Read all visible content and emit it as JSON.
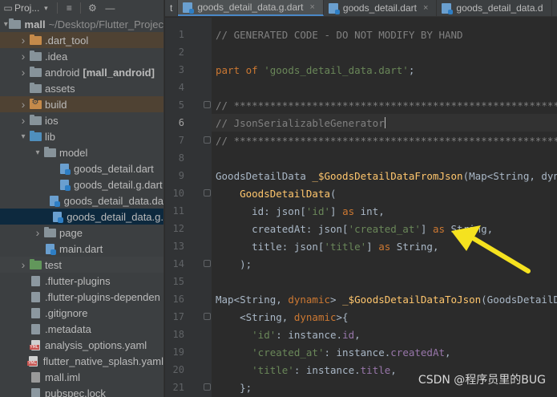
{
  "project_panel": {
    "title": "Proj...",
    "tree": [
      {
        "label": "mall",
        "extra": "~/Desktop/Flutter_Projec",
        "depth": 0,
        "arrow": "down",
        "icon": "folder",
        "bold": true
      },
      {
        "label": ".dart_tool",
        "depth": 1,
        "arrow": "right",
        "icon": "folder-orange",
        "style": "excluded"
      },
      {
        "label": ".idea",
        "depth": 1,
        "arrow": "right",
        "icon": "folder"
      },
      {
        "label": "android",
        "extra": "[mall_android]",
        "depth": 1,
        "arrow": "right",
        "icon": "folder",
        "extra_bold": true
      },
      {
        "label": "assets",
        "depth": 1,
        "arrow": "",
        "icon": "folder"
      },
      {
        "label": "build",
        "depth": 1,
        "arrow": "right",
        "icon": "folder-orange-gear",
        "style": "excluded"
      },
      {
        "label": "ios",
        "depth": 1,
        "arrow": "right",
        "icon": "folder"
      },
      {
        "label": "lib",
        "depth": 1,
        "arrow": "down",
        "icon": "folder-blue"
      },
      {
        "label": "model",
        "depth": 2,
        "arrow": "down",
        "icon": "folder"
      },
      {
        "label": "goods_detail.dart",
        "depth": 3,
        "arrow": "",
        "icon": "file-dart"
      },
      {
        "label": "goods_detail.g.dart",
        "depth": 3,
        "arrow": "",
        "icon": "file-dart"
      },
      {
        "label": "goods_detail_data.da",
        "depth": 3,
        "arrow": "",
        "icon": "file-dart"
      },
      {
        "label": "goods_detail_data.g.",
        "depth": 3,
        "arrow": "",
        "icon": "file-dart",
        "style": "selected"
      },
      {
        "label": "page",
        "depth": 2,
        "arrow": "right",
        "icon": "folder"
      },
      {
        "label": "main.dart",
        "depth": 2,
        "arrow": "",
        "icon": "file-dart"
      },
      {
        "label": "test",
        "depth": 1,
        "arrow": "right",
        "icon": "folder-green",
        "style": "light"
      },
      {
        "label": ".flutter-plugins",
        "depth": 1,
        "arrow": "",
        "icon": "file-plain"
      },
      {
        "label": ".flutter-plugins-dependen",
        "depth": 1,
        "arrow": "",
        "icon": "file-plain"
      },
      {
        "label": ".gitignore",
        "depth": 1,
        "arrow": "",
        "icon": "file-plain"
      },
      {
        "label": ".metadata",
        "depth": 1,
        "arrow": "",
        "icon": "file-plain"
      },
      {
        "label": "analysis_options.yaml",
        "depth": 1,
        "arrow": "",
        "icon": "file-yaml"
      },
      {
        "label": "flutter_native_splash.yaml",
        "depth": 1,
        "arrow": "",
        "icon": "file-yaml"
      },
      {
        "label": "mall.iml",
        "depth": 1,
        "arrow": "",
        "icon": "file-iml"
      },
      {
        "label": "pubspec.lock",
        "depth": 1,
        "arrow": "",
        "icon": "file-plain"
      }
    ]
  },
  "tabs": {
    "fragment": "t",
    "items": [
      {
        "label": "goods_detail_data.g.dart",
        "active": true
      },
      {
        "label": "goods_detail.dart",
        "active": false
      },
      {
        "label": "goods_detail_data.d",
        "active": false
      }
    ]
  },
  "editor": {
    "current_line": 6,
    "lines": [
      {
        "n": "1",
        "tokens": [
          [
            "c-com",
            "// GENERATED CODE - DO NOT MODIFY BY HAND"
          ]
        ]
      },
      {
        "n": "2",
        "tokens": []
      },
      {
        "n": "3",
        "tokens": [
          [
            "c-kw",
            "part of "
          ],
          [
            "c-str",
            "'goods_detail_data.dart'"
          ],
          [
            "c-cls",
            ";"
          ]
        ]
      },
      {
        "n": "4",
        "tokens": []
      },
      {
        "n": "5",
        "fold": true,
        "tokens": [
          [
            "c-com",
            "// **************************************************************************"
          ]
        ]
      },
      {
        "n": "6",
        "tokens": [
          [
            "c-com",
            "// JsonSerializableGenerator"
          ]
        ],
        "caret": true
      },
      {
        "n": "7",
        "fold": true,
        "tokens": [
          [
            "c-com",
            "// **************************************************************************"
          ]
        ]
      },
      {
        "n": "8",
        "tokens": []
      },
      {
        "n": "9",
        "tokens": [
          [
            "c-cls",
            "GoodsDetailData "
          ],
          [
            "c-fn",
            "_$GoodsDetailDataFromJson"
          ],
          [
            "c-cls",
            "(Map<String, dynamic> json) =>"
          ]
        ]
      },
      {
        "n": "10",
        "fold": true,
        "tokens": [
          [
            "c-cls",
            "    "
          ],
          [
            "c-fn",
            "GoodsDetailData"
          ],
          [
            "c-cls",
            "("
          ]
        ]
      },
      {
        "n": "11",
        "tokens": [
          [
            "c-cls",
            "      id: json["
          ],
          [
            "c-str",
            "'id'"
          ],
          [
            "c-cls",
            "] "
          ],
          [
            "c-kw",
            "as "
          ],
          [
            "c-cls",
            "int,"
          ]
        ]
      },
      {
        "n": "12",
        "tokens": [
          [
            "c-cls",
            "      createdAt: json["
          ],
          [
            "c-str",
            "'created_at'"
          ],
          [
            "c-cls",
            "] "
          ],
          [
            "c-kw",
            "as "
          ],
          [
            "c-cls",
            "String,"
          ]
        ]
      },
      {
        "n": "13",
        "tokens": [
          [
            "c-cls",
            "      title: json["
          ],
          [
            "c-str",
            "'title'"
          ],
          [
            "c-cls",
            "] "
          ],
          [
            "c-kw",
            "as "
          ],
          [
            "c-cls",
            "String,"
          ]
        ]
      },
      {
        "n": "14",
        "fold": true,
        "tokens": [
          [
            "c-cls",
            "    );"
          ]
        ]
      },
      {
        "n": "15",
        "tokens": []
      },
      {
        "n": "16",
        "tokens": [
          [
            "c-cls",
            "Map<String, "
          ],
          [
            "c-kw",
            "dynamic"
          ],
          [
            "c-cls",
            "> "
          ],
          [
            "c-fn",
            "_$GoodsDetailDataToJson"
          ],
          [
            "c-cls",
            "(GoodsDetailData instance) =>"
          ]
        ]
      },
      {
        "n": "17",
        "fold": true,
        "tokens": [
          [
            "c-cls",
            "    <String, "
          ],
          [
            "c-kw",
            "dynamic"
          ],
          [
            "c-cls",
            ">{"
          ]
        ]
      },
      {
        "n": "18",
        "tokens": [
          [
            "c-cls",
            "      "
          ],
          [
            "c-str",
            "'id'"
          ],
          [
            "c-cls",
            ": instance."
          ],
          [
            "c-prop",
            "id"
          ],
          [
            "c-cls",
            ","
          ]
        ]
      },
      {
        "n": "19",
        "tokens": [
          [
            "c-cls",
            "      "
          ],
          [
            "c-str",
            "'created_at'"
          ],
          [
            "c-cls",
            ": instance."
          ],
          [
            "c-prop",
            "createdAt"
          ],
          [
            "c-cls",
            ","
          ]
        ]
      },
      {
        "n": "20",
        "tokens": [
          [
            "c-cls",
            "      "
          ],
          [
            "c-str",
            "'title'"
          ],
          [
            "c-cls",
            ": instance."
          ],
          [
            "c-prop",
            "title"
          ],
          [
            "c-cls",
            ","
          ]
        ]
      },
      {
        "n": "21",
        "fold": true,
        "tokens": [
          [
            "c-cls",
            "    };"
          ]
        ]
      }
    ]
  },
  "watermark": "CSDN @程序员里的BUG",
  "colors": {
    "arrow": "#f5e21f",
    "selected_row": "#0d293e",
    "excluded_row": "#4f4233"
  }
}
